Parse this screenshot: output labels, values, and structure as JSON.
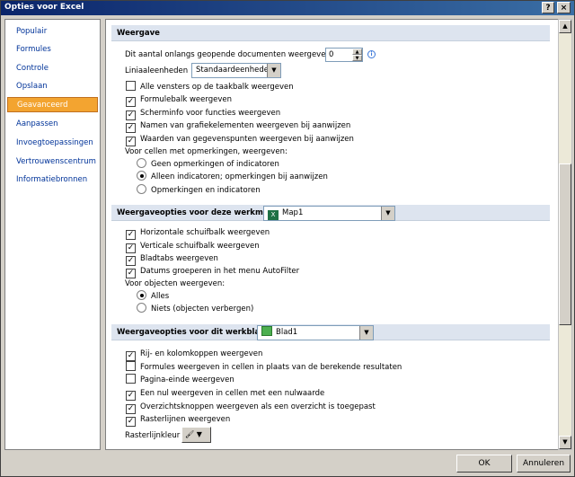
{
  "window": {
    "title": "Opties voor Excel",
    "help": "?",
    "close": "×"
  },
  "nav": {
    "items": [
      {
        "label": "Populair",
        "active": false
      },
      {
        "label": "Formules",
        "active": false
      },
      {
        "label": "Controle",
        "active": false
      },
      {
        "label": "Opslaan",
        "active": false
      },
      {
        "label": "Geavanceerd",
        "active": true
      },
      {
        "label": "Aanpassen",
        "active": false
      },
      {
        "label": "Invoegtoepassingen",
        "active": false
      },
      {
        "label": "Vertrouwenscentrum",
        "active": false
      },
      {
        "label": "Informatiebronnen",
        "active": false
      }
    ]
  },
  "weergave": {
    "header": "Weergave",
    "recent_label": "Dit aantal onlangs geopende documenten weergeven:",
    "recent_value": "0",
    "ruler_label": "Liniaaleenheden",
    "ruler_value": "Standaardeenheden",
    "checks": [
      {
        "label": "Alle vensters op de taakbalk weergeven",
        "checked": false
      },
      {
        "label": "Formulebalk weergeven",
        "checked": true
      },
      {
        "label": "Scherminfo voor functies weergeven",
        "checked": true
      },
      {
        "label": "Namen van grafiekelementen weergeven bij aanwijzen",
        "checked": true
      },
      {
        "label": "Waarden van gegevenspunten weergeven bij aanwijzen",
        "checked": true
      }
    ],
    "comments_label": "Voor cellen met opmerkingen, weergeven:",
    "comment_options": [
      {
        "label": "Geen opmerkingen of indicatoren",
        "selected": false
      },
      {
        "label": "Alleen indicatoren; opmerkingen bij aanwijzen",
        "selected": true
      },
      {
        "label": "Opmerkingen en indicatoren",
        "selected": false
      }
    ]
  },
  "workbook": {
    "header": "Weergaveopties voor deze werkmap:",
    "selected": "Map1",
    "checks": [
      {
        "label": "Horizontale schuifbalk weergeven",
        "checked": true
      },
      {
        "label": "Verticale schuifbalk weergeven",
        "checked": true
      },
      {
        "label": "Bladtabs weergeven",
        "checked": true
      },
      {
        "label": "Datums groeperen in het menu AutoFilter",
        "checked": true
      }
    ],
    "objects_label": "Voor objecten weergeven:",
    "object_options": [
      {
        "label": "Alles",
        "selected": true
      },
      {
        "label": "Niets (objecten verbergen)",
        "selected": false
      }
    ]
  },
  "worksheet": {
    "header": "Weergaveopties voor dit werkblad:",
    "selected": "Blad1",
    "checks": [
      {
        "label": "Rij- en kolomkoppen weergeven",
        "checked": true
      },
      {
        "label": "Formules weergeven in cellen in plaats van de berekende resultaten",
        "checked": false
      },
      {
        "label": "Pagina-einde weergeven",
        "checked": false
      },
      {
        "label": "Een nul weergeven in cellen met een nulwaarde",
        "checked": true
      },
      {
        "label": "Overzichtsknoppen weergeven als een overzicht is toegepast",
        "checked": true
      },
      {
        "label": "Rasterlijnen weergeven",
        "checked": true
      }
    ],
    "gridcolor_label": "Rasterlijnkleur"
  },
  "buttons": {
    "ok": "OK",
    "cancel": "Annuleren"
  }
}
